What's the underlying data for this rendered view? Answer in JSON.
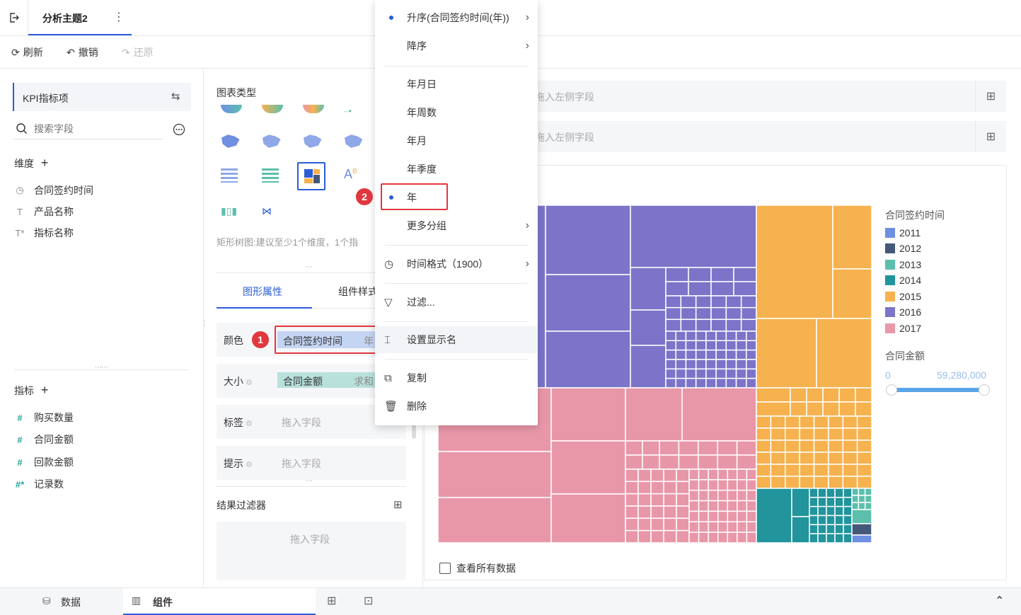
{
  "header": {
    "title": "分析主题2",
    "more_icon": "more-vertical-icon",
    "back_icon": "exit-icon"
  },
  "toolbar": {
    "refresh": "刷新",
    "undo": "撤销",
    "redo": "还原"
  },
  "left_panel": {
    "dataset": "KPI指标项",
    "search_placeholder": "搜索字段",
    "dimensions_title": "维度",
    "dimensions": [
      {
        "icon": "clock-icon",
        "label": "合同签约时间"
      },
      {
        "icon": "text-type-icon",
        "label": "产品名称"
      },
      {
        "icon": "text-type-star-icon",
        "label": "指标名称"
      }
    ],
    "measures_title": "指标",
    "measures": [
      {
        "icon": "hash-icon",
        "label": "购买数量"
      },
      {
        "icon": "hash-icon",
        "label": "合同金额"
      },
      {
        "icon": "hash-icon",
        "label": "回款金额"
      },
      {
        "icon": "hash-star-icon",
        "label": "记录数"
      }
    ]
  },
  "mid_panel": {
    "chart_type_title": "图表类型",
    "chart_hint": "矩形树图:建议至少1个维度，1个指",
    "tabs": [
      "图形属性",
      "组件样式"
    ],
    "props": {
      "color_label": "颜色",
      "color_field": "合同签约时间",
      "color_field_suffix": "年",
      "size_label": "大小",
      "size_field": "合同金额",
      "size_field_suffix": "求和",
      "label_label": "标签",
      "tooltip_label": "提示",
      "drop_placeholder": "拖入字段"
    },
    "result_filter_title": "结果过滤器",
    "result_filter_placeholder": "拖入字段"
  },
  "canvas": {
    "row_placeholder": "拖入左侧字段",
    "col_placeholder": "拖入左侧字段",
    "view_all": "查看所有数据",
    "legend_title": "合同签约时间",
    "legend": [
      {
        "label": "2011",
        "color": "#6f8fe3"
      },
      {
        "label": "2012",
        "color": "#44587a"
      },
      {
        "label": "2013",
        "color": "#5cbfad"
      },
      {
        "label": "2014",
        "color": "#21949c"
      },
      {
        "label": "2015",
        "color": "#f6b24e"
      },
      {
        "label": "2016",
        "color": "#7c74c8"
      },
      {
        "label": "2017",
        "color": "#e897a9"
      }
    ],
    "size_legend_title": "合同金额",
    "size_min": "0",
    "size_max": "59,280,000"
  },
  "context_menu": {
    "asc": "升序(合同签约时间(年))",
    "desc": "降序",
    "ymd": "年月日",
    "yw": "年周数",
    "ym": "年月",
    "yq": "年季度",
    "y": "年",
    "more_group": "更多分组",
    "time_format": "时间格式（1900）",
    "filter": "过滤...",
    "display_name": "设置显示名",
    "copy": "复制",
    "delete": "删除"
  },
  "annotations": {
    "badge1": "1",
    "badge2": "2"
  },
  "bottom": {
    "data_tab": "数据",
    "component_tab": "组件"
  },
  "colors": {
    "accent": "#2b5cd8",
    "annotation_red": "#e0383e"
  }
}
